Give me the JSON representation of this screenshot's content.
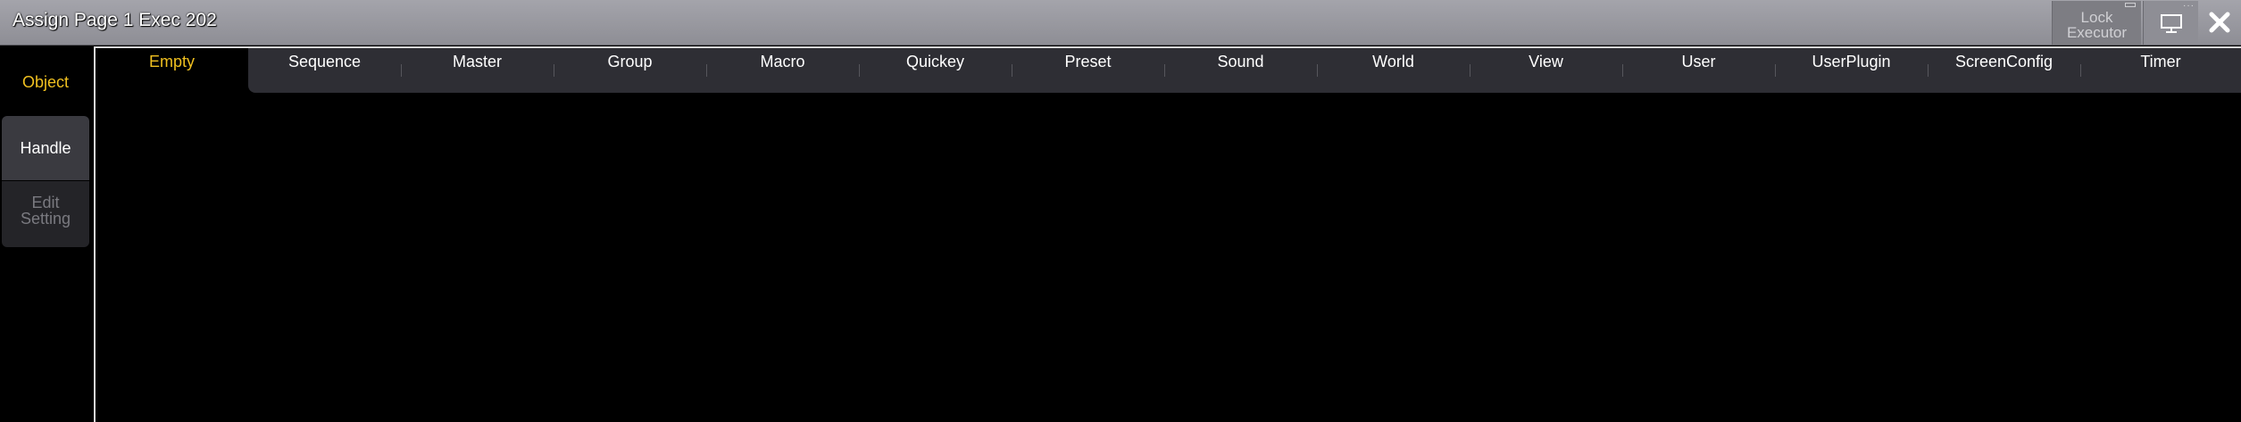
{
  "window": {
    "title": "Assign Page 1 Exec 202",
    "lock_button": {
      "line1": "Lock",
      "line2": "Executor"
    }
  },
  "sidebar": {
    "items": [
      {
        "label": "Object",
        "state": "selected"
      },
      {
        "label": "Handle",
        "state": "normal"
      },
      {
        "label_line1": "Edit",
        "label_line2": "Setting",
        "state": "disabled"
      }
    ]
  },
  "tabs": {
    "active_index": 0,
    "items": [
      {
        "label": "Empty"
      },
      {
        "label": "Sequence"
      },
      {
        "label": "Master"
      },
      {
        "label": "Group"
      },
      {
        "label": "Macro"
      },
      {
        "label": "Quickey"
      },
      {
        "label": "Preset"
      },
      {
        "label": "Sound"
      },
      {
        "label": "World"
      },
      {
        "label": "View"
      },
      {
        "label": "User"
      },
      {
        "label": "UserPlugin"
      },
      {
        "label": "ScreenConfig"
      },
      {
        "label": "Timer"
      }
    ]
  },
  "colors": {
    "accent": "#f0c020",
    "titlebar": "#9a9aa1",
    "tab_bar": "#2e2e34",
    "background": "#000000"
  },
  "icons": {
    "display": "monitor-icon",
    "close": "close-icon"
  }
}
